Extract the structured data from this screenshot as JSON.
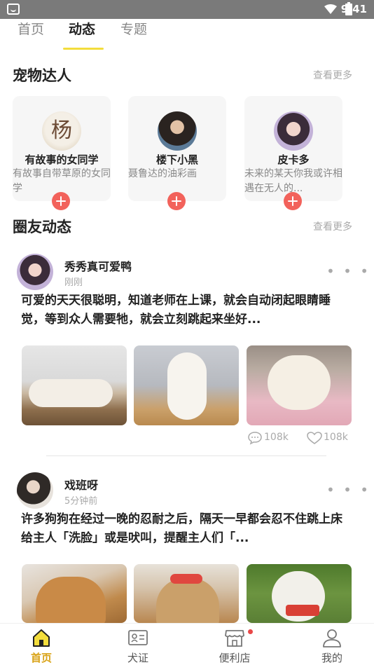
{
  "status_bar": {
    "time": "9:41"
  },
  "tabs": [
    {
      "label": "首页"
    },
    {
      "label": "动态"
    },
    {
      "label": "专题"
    }
  ],
  "experts_section": {
    "title": "宠物达人",
    "see_more": "查看更多",
    "cards": [
      {
        "name": "有故事的女同学",
        "desc": "有故事自带草原的女同学",
        "avatar_text": "杨"
      },
      {
        "name": "楼下小黑",
        "desc": "聂鲁达的油彩画"
      },
      {
        "name": "皮卡多",
        "desc": "未来的某天你我或许相遇在无人的..."
      }
    ]
  },
  "feed_section": {
    "title": "圈友动态",
    "see_more": "查看更多",
    "posts": [
      {
        "user": "秀秀真可爱鸭",
        "time": "刚刚",
        "more": "• • •",
        "text": "可爱的天天很聪明，知道老师在上课，就会自动闭起眼睛睡觉，等到众人需要牠，就会立刻跳起来坐好...",
        "comments": "108k",
        "likes": "108k"
      },
      {
        "user": "戏班呀",
        "time": "5分钟前",
        "more": "• • •",
        "text": "许多狗狗在经过一晚的忍耐之后，隔天一早都会忍不住跳上床给主人「洗脸」或是吠叫，提醒主人们「..."
      }
    ]
  },
  "bottom_nav": [
    {
      "label": "首页",
      "icon": "home-icon",
      "active": true
    },
    {
      "label": "犬证",
      "icon": "id-card-icon"
    },
    {
      "label": "便利店",
      "icon": "store-icon"
    },
    {
      "label": "我的",
      "icon": "user-icon"
    }
  ],
  "colors": {
    "accent_yellow": "#f3dd3c",
    "active_nav": "#d9a317",
    "follow_red": "#f2625b",
    "status_bar": "#7a7a7a"
  }
}
